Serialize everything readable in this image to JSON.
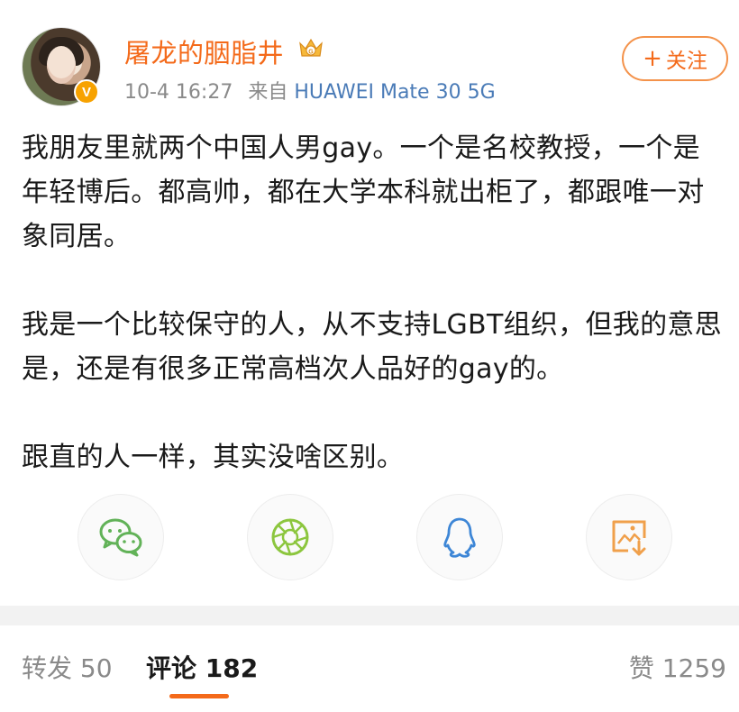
{
  "header": {
    "username": "屠龙的胭脂井",
    "timestamp": "10-4 16:27",
    "source_prefix": "来自",
    "source_device": "HUAWEI Mate 30 5G",
    "verified_badge": "V",
    "follow_plus": "+",
    "follow_label": "关注"
  },
  "post": {
    "paragraphs": [
      "我朋友里就两个中国人男gay。一个是名校教授，一个是年轻博后。都高帅，都在大学本科就出柜了，都跟唯一对象同居。",
      "我是一个比较保守的人，从不支持LGBT组织，但我的意思是，还是有很多正常高档次人品好的gay的。",
      "跟直的人一样，其实没啥区别。"
    ]
  },
  "share": {
    "icons": [
      "wechat-icon",
      "moments-icon",
      "qq-icon",
      "save-image-icon"
    ]
  },
  "tabs": {
    "repost_label": "转发 50",
    "comment_label": "评论 182",
    "like_label": "赞 1259"
  },
  "colors": {
    "accent": "#f46a1a",
    "source_link": "#4a7bb7",
    "wechat": "#62b258",
    "moments": "#8cc63e",
    "qq": "#3d86d6",
    "save": "#f0a04b"
  }
}
